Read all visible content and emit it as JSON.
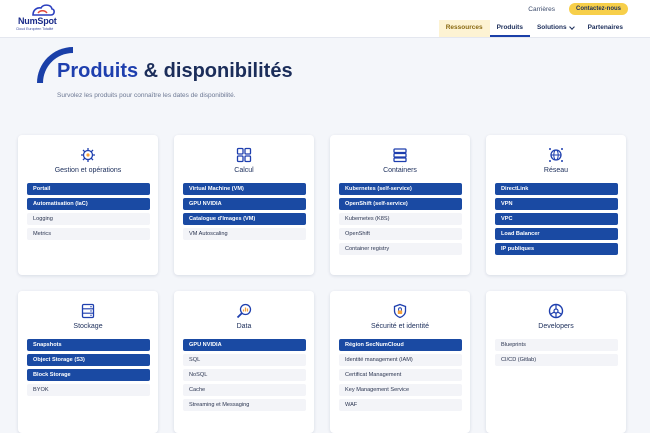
{
  "logo": {
    "name": "NumSpot",
    "tagline": "Cloud Européen Totalité"
  },
  "top": {
    "careers": "Carrières",
    "contact": "Contactez-nous"
  },
  "nav": [
    {
      "label": "Ressources"
    },
    {
      "label": "Produits"
    },
    {
      "label": "Solutions"
    },
    {
      "label": "Partenaires"
    }
  ],
  "hero": {
    "title_main": "Produits",
    "title_rest": " & disponibilités",
    "subtitle": "Survolez les produits pour connaître les dates de disponibilité."
  },
  "cards": [
    {
      "title": "Gestion et opérations",
      "icon": "gear-settings-icon",
      "items": [
        {
          "label": "Portail",
          "state": "on"
        },
        {
          "label": "Automatisation (IaC)",
          "state": "on"
        },
        {
          "label": "Logging",
          "state": "off"
        },
        {
          "label": "Metrics",
          "state": "off"
        }
      ]
    },
    {
      "title": "Calcul",
      "icon": "compute-grid-icon",
      "items": [
        {
          "label": "Virtual Machine (VM)",
          "state": "on"
        },
        {
          "label": "GPU NVIDIA",
          "state": "on"
        },
        {
          "label": "Catalogue d'Images (VM)",
          "state": "on"
        },
        {
          "label": "VM Autoscaling",
          "state": "off"
        }
      ]
    },
    {
      "title": "Containers",
      "icon": "container-stack-icon",
      "items": [
        {
          "label": "Kubernetes (self-service)",
          "state": "on"
        },
        {
          "label": "OpenShift (self-service)",
          "state": "on"
        },
        {
          "label": "Kubernetes (K8S)",
          "state": "off"
        },
        {
          "label": "OpenShift",
          "state": "off"
        },
        {
          "label": "Container registry",
          "state": "off"
        }
      ]
    },
    {
      "title": "Réseau",
      "icon": "network-globe-icon",
      "items": [
        {
          "label": "DirectLink",
          "state": "on"
        },
        {
          "label": "VPN",
          "state": "on"
        },
        {
          "label": "VPC",
          "state": "on"
        },
        {
          "label": "Load Balancer",
          "state": "on"
        },
        {
          "label": "IP publiques",
          "state": "on"
        }
      ]
    },
    {
      "title": "Stockage",
      "icon": "storage-server-icon",
      "items": [
        {
          "label": "Snapshots",
          "state": "on"
        },
        {
          "label": "Object Storage (S3)",
          "state": "on"
        },
        {
          "label": "Block Storage",
          "state": "on"
        },
        {
          "label": "BYOK",
          "state": "off"
        }
      ]
    },
    {
      "title": "Data",
      "icon": "data-search-icon",
      "items": [
        {
          "label": "GPU NVIDIA",
          "state": "on"
        },
        {
          "label": "SQL",
          "state": "off"
        },
        {
          "label": "NoSQL",
          "state": "off"
        },
        {
          "label": "Cache",
          "state": "off"
        },
        {
          "label": "Streaming et Messaging",
          "state": "off"
        }
      ]
    },
    {
      "title": "Sécurité et identité",
      "icon": "security-shield-icon",
      "items": [
        {
          "label": "Région SecNumCloud",
          "state": "on"
        },
        {
          "label": "Identité management (IAM)",
          "state": "off"
        },
        {
          "label": "Certificat Management",
          "state": "off"
        },
        {
          "label": "Key Management Service",
          "state": "off"
        },
        {
          "label": "WAF",
          "state": "off"
        }
      ]
    },
    {
      "title": "Developers",
      "icon": "developer-wheel-icon",
      "items": [
        {
          "label": "Blueprints",
          "state": "off"
        },
        {
          "label": "CI/CD (Gitlab)",
          "state": "off"
        }
      ]
    }
  ],
  "colors": {
    "available": "#1a4aa3",
    "unavailable": "#f3f4f8",
    "accent": "#1e3fae",
    "contact": "#f7cf4a"
  }
}
